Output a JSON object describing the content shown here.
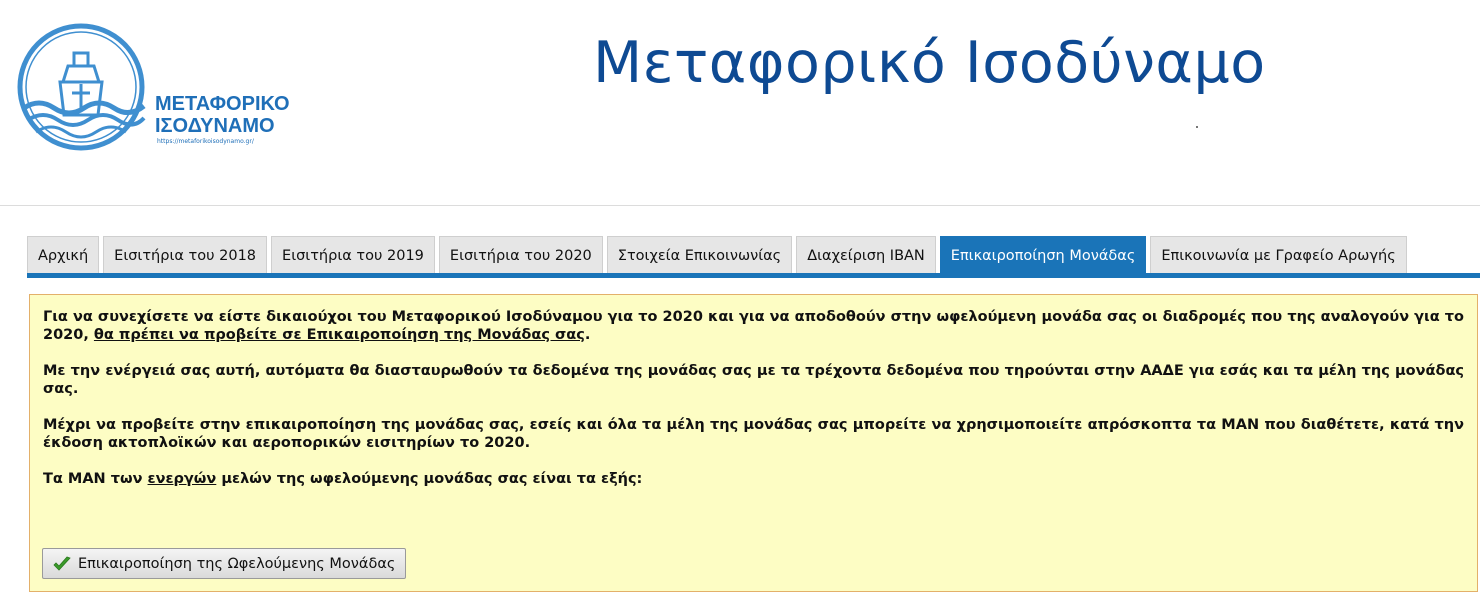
{
  "header": {
    "site_title": "Μεταφορικό Ισοδύναμο",
    "logo": {
      "line1": "ΜΕΤΑΦΟΡΙΚΟ",
      "line2": "ΙΣΟΔΥΝΑΜΟ",
      "url": "https://metaforikoisodynamo.gr/",
      "icon": "ship-waves-logo"
    }
  },
  "tabs": [
    {
      "label": "Αρχική",
      "active": false
    },
    {
      "label": "Εισιτήρια του 2018",
      "active": false
    },
    {
      "label": "Εισιτήρια του 2019",
      "active": false
    },
    {
      "label": "Εισιτήρια του 2020",
      "active": false
    },
    {
      "label": "Στοιχεία Επικοινωνίας",
      "active": false
    },
    {
      "label": "Διαχείριση IBAN",
      "active": false
    },
    {
      "label": "Επικαιροποίηση Μονάδας",
      "active": true
    },
    {
      "label": "Επικοινωνία με Γραφείο Αρωγής",
      "active": false
    }
  ],
  "notice": {
    "p1_text": "Για να συνεχίσετε να είστε δικαιούχοι του Μεταφορικού Ισοδύναμου για το 2020 και για να αποδοθούν στην ωφελούμενη μονάδα σας οι διαδρομές που της αναλογούν για το 2020, ",
    "p1_link": "θα πρέπει να προβείτε σε Επικαιροποίηση της Μονάδας σας",
    "p1_end": ".",
    "p2": "Με την ενέργειά σας αυτή, αυτόματα θα διασταυρωθούν τα δεδομένα της μονάδας σας με τα τρέχοντα δεδομένα που τηρούνται στην ΑΑΔΕ για εσάς και τα μέλη της μονάδας σας.",
    "p3": "Μέχρι να προβείτε στην επικαιροποίηση της μονάδας σας, εσείς και όλα τα μέλη της μονάδας σας μπορείτε να χρησιμοποιείτε απρόσκοπτα τα ΜΑΝ που διαθέτετε, κατά την έκδοση ακτοπλοϊκών και αεροπορικών εισιτηρίων το 2020.",
    "p4_start": "Τα ΜΑΝ των ",
    "p4_emph": "ενεργών",
    "p4_end": " μελών της ωφελούμενης μονάδας σας είναι τα εξής:",
    "button_label": "Επικαιροποίηση της Ωφελούμενης Μονάδας",
    "button_icon": "check-icon"
  },
  "colors": {
    "brand_blue": "#0e4a93",
    "tab_active": "#1a74b8",
    "notice_bg": "#fdfdc4",
    "notice_border": "#e3b06a",
    "check_green": "#3a9a2a"
  }
}
